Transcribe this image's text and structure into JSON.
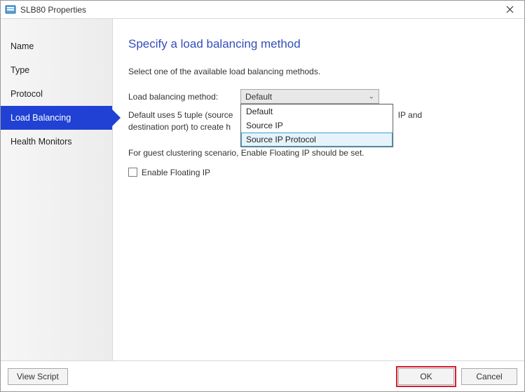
{
  "window": {
    "title": "SLB80 Properties"
  },
  "sidebar": {
    "items": [
      {
        "label": "Name"
      },
      {
        "label": "Type"
      },
      {
        "label": "Protocol"
      },
      {
        "label": "Load Balancing"
      },
      {
        "label": "Health Monitors"
      }
    ],
    "selected_index": 3
  },
  "page": {
    "title": "Specify a load balancing method",
    "subtitle": "Select one of the available load balancing methods.",
    "method_label": "Load balancing method:",
    "method_selected": "Default",
    "method_options": [
      "Default",
      "Source IP",
      "Source IP Protocol"
    ],
    "method_hover_index": 2,
    "description": "Default uses 5 tuple (source IP, source port, destination IP, protocol, destination port) to create hash.",
    "description_visible_fragment_1": "Default uses 5 tuple (source",
    "description_visible_fragment_2": "IP and",
    "description_visible_fragment_3": "destination port) to create h",
    "note": "For guest clustering scenario, Enable Floating IP should be set.",
    "floating_label": "Enable Floating IP",
    "floating_checked": false
  },
  "footer": {
    "view_script": "View Script",
    "ok": "OK",
    "cancel": "Cancel"
  }
}
